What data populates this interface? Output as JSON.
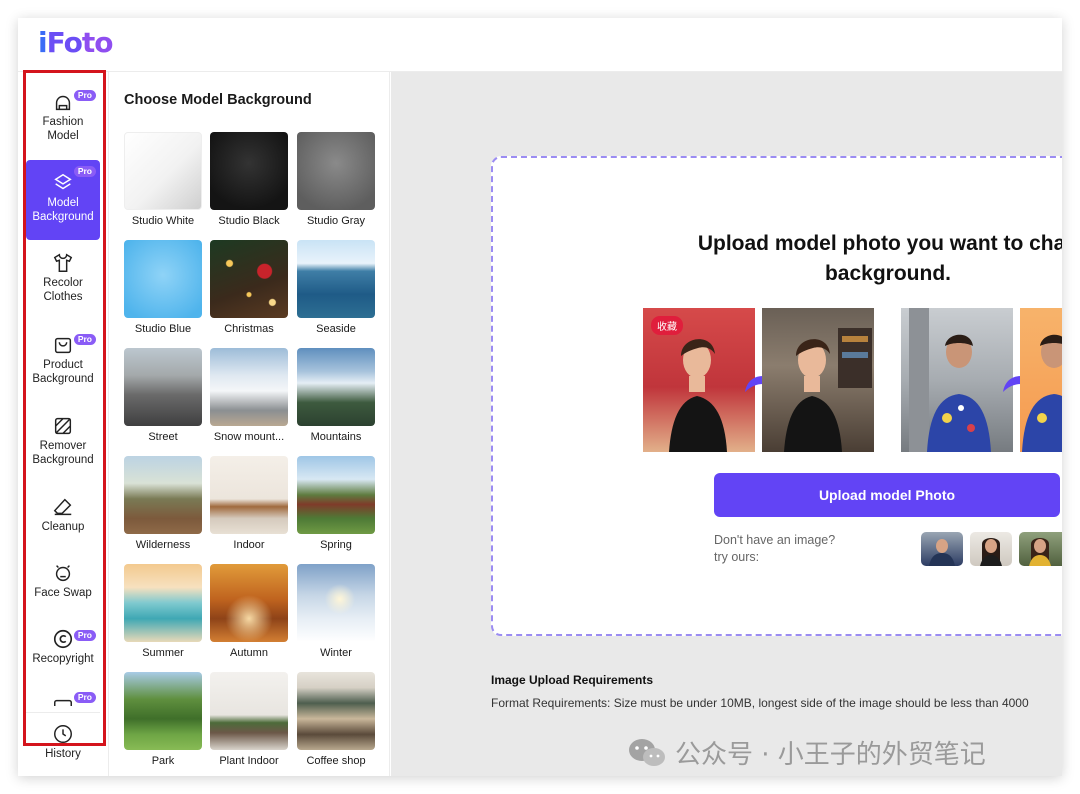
{
  "app": {
    "logo": "iFoto"
  },
  "sidebar": {
    "items": [
      {
        "label": "Fashion Model",
        "icon": "fashion-model-icon",
        "pro": "Pro"
      },
      {
        "label": "Model Background",
        "icon": "layers-icon",
        "pro": "Pro",
        "active": true
      },
      {
        "label": "Recolor Clothes",
        "icon": "tshirt-icon"
      },
      {
        "label": "Product Background",
        "icon": "bag-icon",
        "pro": "Pro"
      },
      {
        "label": "Remover Background",
        "icon": "hatched-square-icon"
      },
      {
        "label": "Cleanup",
        "icon": "eraser-icon"
      },
      {
        "label": "Face Swap",
        "icon": "face-swap-icon"
      },
      {
        "label": "Recopyright",
        "icon": "copyright-icon",
        "pro": "Pro"
      },
      {
        "label": "",
        "icon": "hd-icon",
        "pro": "Pro"
      },
      {
        "label": "History",
        "icon": "clock-icon"
      }
    ]
  },
  "panel": {
    "title": "Choose Model Background",
    "backgrounds": [
      "Studio White",
      "Studio Black",
      "Studio Gray",
      "Studio Blue",
      "Christmas",
      "Seaside",
      "Street",
      "Snow mount...",
      "Mountains",
      "Wilderness",
      "Indoor",
      "Spring",
      "Summer",
      "Autumn",
      "Winter",
      "Park",
      "Plant Indoor",
      "Coffee shop"
    ]
  },
  "main": {
    "upload_title_line1": "Upload model photo you want to chan",
    "upload_title_line2": "background.",
    "save_chip": "收藏",
    "upload_button": "Upload model Photo",
    "try_line1": "Don't have an image?",
    "try_line2": "try ours:",
    "requirements_title": "Image Upload Requirements",
    "requirements_text": "Format Requirements: Size must be under 10MB, longest side of the image should be less than 4000"
  },
  "watermark": "公众号 · 小王子的外贸笔记",
  "colors": {
    "accent": "#6244f5",
    "pro_badge": "#8a5cf6",
    "highlight_outline": "#d4141c"
  }
}
